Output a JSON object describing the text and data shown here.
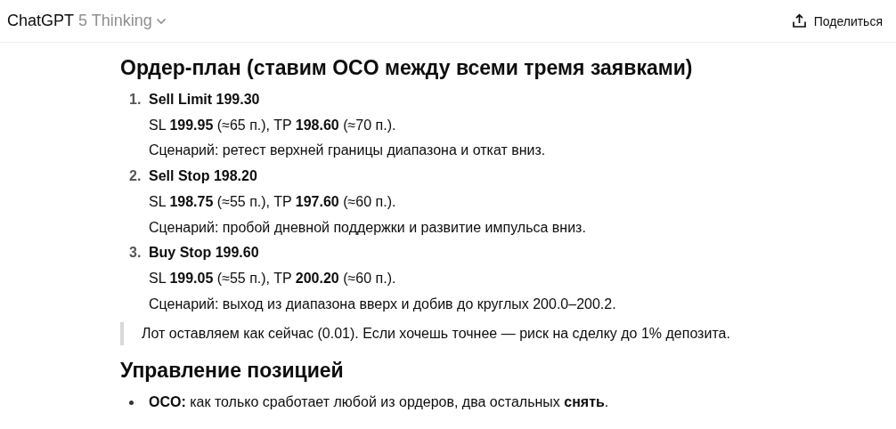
{
  "header": {
    "brand": "ChatGPT",
    "model": "5 Thinking",
    "share_button": "Поделиться"
  },
  "blocks": [
    {
      "kind": "heading",
      "text": "Ордер-план (ставим OCO между всеми тремя заявками)"
    },
    {
      "kind": "ordered_list",
      "items": [
        {
          "number": "1.",
          "title": "Sell Limit 199.30",
          "lines": [
            "SL **199.95** (≈65 п.), TP **198.60** (≈70 п.).",
            "Сценарий: ретест верхней границы диапазона и откат вниз."
          ]
        },
        {
          "number": "2.",
          "title": "Sell Stop 198.20",
          "lines": [
            "SL **198.75** (≈55 п.), TP **197.60** (≈60 п.).",
            "Сценарий: пробой дневной поддержки и развитие импульса вниз."
          ]
        },
        {
          "number": "3.",
          "title": "Buy Stop 199.60",
          "lines": [
            "SL **199.05** (≈55 п.), TP **200.20** (≈60 п.).",
            "Сценарий: выход из диапазона вверх и добив до круглых 200.0–200.2."
          ]
        }
      ]
    },
    {
      "kind": "quote",
      "text": "Лот оставляем как сейчас (0.01). Если хочешь точнее — риск на сделку до 1% депозита."
    },
    {
      "kind": "heading",
      "text": "Управление позицией"
    },
    {
      "kind": "bullet_list",
      "items": [
        "**OCO:** как только сработает любой из ордеров, два остальных **снять**."
      ]
    }
  ]
}
